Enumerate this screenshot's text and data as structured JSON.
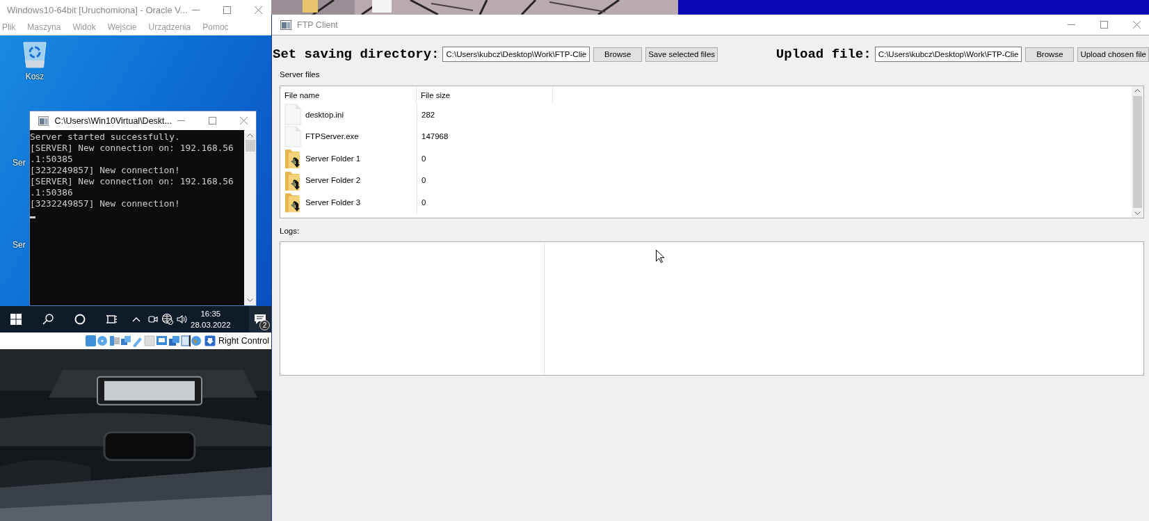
{
  "vm_window": {
    "title": "Windows10-64bit [Uruchomiona] - Oracle V...",
    "menu": [
      "Plik",
      "Maszyna",
      "Widok",
      "Wejście",
      "Urządzenia",
      "Pomoc"
    ],
    "desktop_icons": [
      {
        "label": "Kosz",
        "kind": "recycle-bin"
      },
      {
        "label": "Ser",
        "kind": "hidden"
      },
      {
        "label": "Ser",
        "kind": "hidden"
      }
    ],
    "console": {
      "title": "C:\\Users\\Win10Virtual\\Deskt...",
      "lines": [
        "Server started successfully.",
        "[SERVER] New connection on: 192.168.56",
        ".1:50385",
        "[3232249857] New connection!",
        "[SERVER] New connection on: 192.168.56",
        ".1:50386",
        "[3232249857] New connection!"
      ]
    },
    "taskbar": {
      "time": "16:35",
      "date": "28.03.2022",
      "notifications": "2"
    },
    "status_bar": {
      "host_key": "Right Control"
    }
  },
  "ftp_window": {
    "title": "FTP Client",
    "save": {
      "label": "Set saving directory:",
      "value": "C:\\Users\\kubcz\\Desktop\\Work\\FTP-Clie",
      "buttons": [
        "Browse",
        "Save selected files"
      ]
    },
    "upload": {
      "label": "Upload file:",
      "value": "C:\\Users\\kubcz\\Desktop\\Work\\FTP-Clie",
      "buttons": [
        "Browse",
        "Upload chosen file"
      ]
    },
    "server_files": {
      "label": "Server files",
      "columns": [
        "File name",
        "File size"
      ],
      "rows": [
        {
          "name": "desktop.ini",
          "size": "282",
          "kind": "file"
        },
        {
          "name": "FTPServer.exe",
          "size": "147968",
          "kind": "file"
        },
        {
          "name": "Server Folder 1",
          "size": "0",
          "kind": "folder"
        },
        {
          "name": "Server Folder 2",
          "size": "0",
          "kind": "folder"
        },
        {
          "name": "Server Folder 3",
          "size": "0",
          "kind": "folder"
        }
      ]
    },
    "logs": {
      "label": "Logs:"
    }
  }
}
